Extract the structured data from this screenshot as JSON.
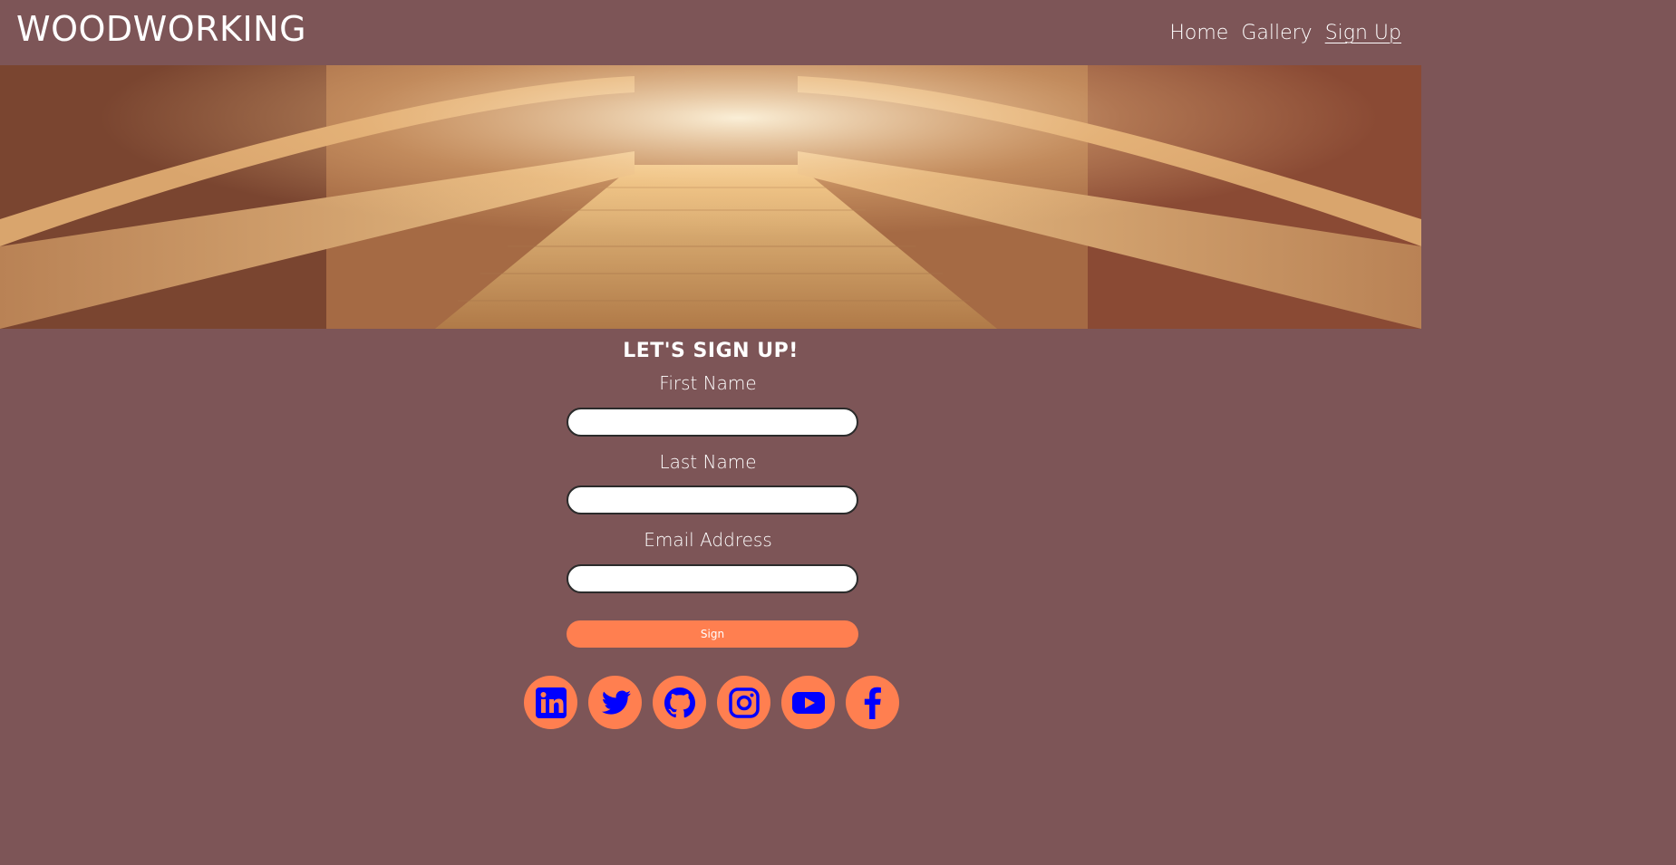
{
  "header": {
    "logo": "WOODWORKING",
    "nav": [
      {
        "label": "Home"
      },
      {
        "label": "Gallery"
      },
      {
        "label": "Sign Up"
      }
    ]
  },
  "form": {
    "title": "LET'S SIGN UP!",
    "fields": [
      {
        "label": "First Name",
        "value": "",
        "placeholder": ""
      },
      {
        "label": "Last Name",
        "value": "",
        "placeholder": ""
      },
      {
        "label": "Email Address",
        "value": "",
        "placeholder": ""
      }
    ],
    "submit_label": "Sign"
  },
  "social": {
    "items": [
      {
        "icon": "linkedin-icon"
      },
      {
        "icon": "twitter-icon"
      },
      {
        "icon": "github-icon"
      },
      {
        "icon": "instagram-icon"
      },
      {
        "icon": "youtube-icon"
      },
      {
        "icon": "facebook-icon"
      }
    ],
    "icon_color": "#0000ff",
    "circle_color": "#ff7f50"
  },
  "colors": {
    "background": "#7d5557",
    "accent": "#ff7f50"
  }
}
